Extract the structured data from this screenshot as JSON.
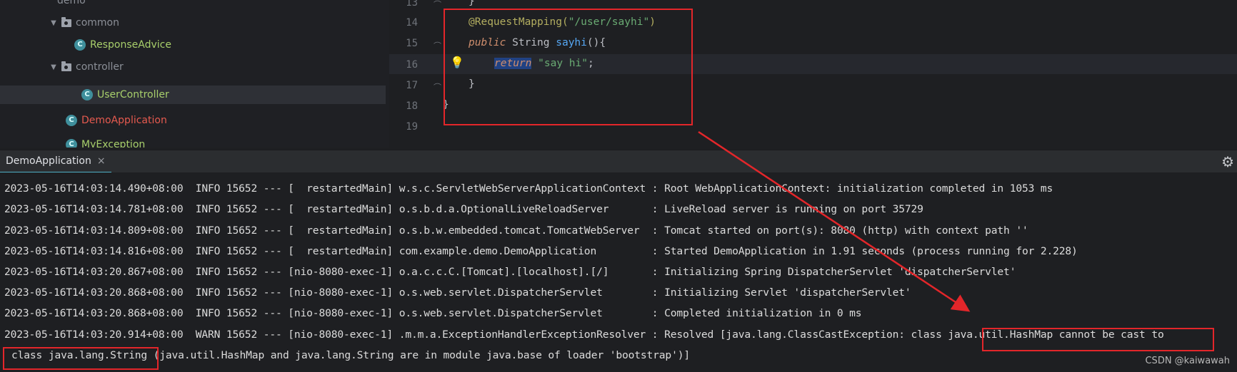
{
  "tree": {
    "top_partial": "demo",
    "items": [
      {
        "kind": "folder",
        "label": "common"
      },
      {
        "kind": "class",
        "label": "ResponseAdvice"
      },
      {
        "kind": "folder",
        "label": "controller"
      },
      {
        "kind": "class",
        "label": "UserController"
      },
      {
        "kind": "class",
        "label": "DemoApplication"
      },
      {
        "kind": "class",
        "label": "MyException"
      }
    ]
  },
  "editor": {
    "line_numbers": [
      "13",
      "14",
      "15",
      "16",
      "17",
      "18",
      "19"
    ],
    "lines": {
      "l13": "}",
      "l14_ann": "@RequestMapping(",
      "l14_str": "\"/user/sayhi\"",
      "l14_end": ")",
      "l15_kw": "public",
      "l15_type": " String ",
      "l15_fn": "sayhi",
      "l15_end": "(){",
      "l16_kw": "return",
      "l16_str": "\"say hi\"",
      "l16_end": ";",
      "l17": "}",
      "l18": "}"
    }
  },
  "run": {
    "tab_label": "DemoApplication",
    "close_glyph": "×",
    "settings_icon": "gear-icon",
    "logs": [
      "2023-05-16T14:03:14.490+08:00  INFO 15652 --- [  restartedMain] w.s.c.ServletWebServerApplicationContext : Root WebApplicationContext: initialization completed in 1053 ms",
      "2023-05-16T14:03:14.781+08:00  INFO 15652 --- [  restartedMain] o.s.b.d.a.OptionalLiveReloadServer       : LiveReload server is running on port 35729",
      "2023-05-16T14:03:14.809+08:00  INFO 15652 --- [  restartedMain] o.s.b.w.embedded.tomcat.TomcatWebServer  : Tomcat started on port(s): 8080 (http) with context path ''",
      "2023-05-16T14:03:14.816+08:00  INFO 15652 --- [  restartedMain] com.example.demo.DemoApplication         : Started DemoApplication in 1.91 seconds (process running for 2.228)",
      "2023-05-16T14:03:20.867+08:00  INFO 15652 --- [nio-8080-exec-1] o.a.c.c.C.[Tomcat].[localhost].[/]       : Initializing Spring DispatcherServlet 'dispatcherServlet'",
      "2023-05-16T14:03:20.868+08:00  INFO 15652 --- [nio-8080-exec-1] o.s.web.servlet.DispatcherServlet        : Initializing Servlet 'dispatcherServlet'",
      "2023-05-16T14:03:20.868+08:00  INFO 15652 --- [nio-8080-exec-1] o.s.web.servlet.DispatcherServlet        : Completed initialization in 0 ms",
      "2023-05-16T14:03:20.914+08:00  WARN 15652 --- [nio-8080-exec-1] .m.m.a.ExceptionHandlerExceptionResolver : Resolved [java.lang.ClassCastException: class java.util.HashMap cannot be cast to",
      "class java.lang.String (java.util.HashMap and java.lang.String are in module java.base of loader 'bootstrap')]"
    ]
  },
  "watermark": "CSDN @kaiwawah",
  "colors": {
    "annotation_box": "#e3262a",
    "accent_tab": "#4fb0c6"
  }
}
